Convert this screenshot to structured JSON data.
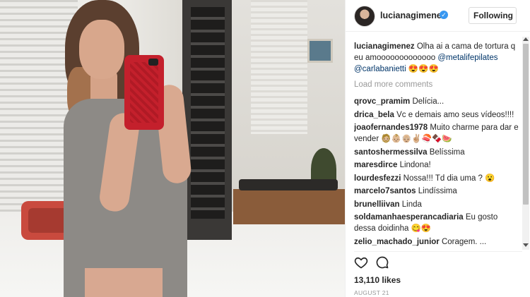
{
  "post": {
    "username": "lucianagimenez",
    "follow_label": "Following",
    "caption_user": "lucianagimenez",
    "caption_text": " Olha ai a cama de tortura q eu amooooooooooooo ",
    "caption_mention1": "@metalifepilates",
    "caption_mention2": "@carlabanietti",
    "caption_emoji": " 😍😍😍",
    "load_more": "Load more comments",
    "likes": "13,110 likes",
    "date": "AUGUST 21"
  },
  "comments": [
    {
      "user": "qrovc_pramim",
      "text": " Delícia..."
    },
    {
      "user": "drica_bela",
      "text": " Vc e demais amo seus vídeos!!!!"
    },
    {
      "user": "joaofernandes1978",
      "text": " Muito charme para dar e vender 🧔🏼👶🏼👴🏼✌🏼🍣🍫🍉"
    },
    {
      "user": "santoshermessilva",
      "text": " Belíssima"
    },
    {
      "user": "maresdirce",
      "text": " Lindona!"
    },
    {
      "user": "lourdesfezzi",
      "text": " Nossa!!! Td dia uma ? 😮"
    },
    {
      "user": "marcelo7santos",
      "text": " Lindíssima"
    },
    {
      "user": "brunelliivan",
      "text": " Linda"
    },
    {
      "user": "soldamanhaesperancadiaria",
      "text": " Eu gosto dessa doidinha 😋😍"
    },
    {
      "user": "zelio_machado_junior",
      "text": " Coragem. ..."
    }
  ],
  "colors": {
    "accent": "#3897f0",
    "link": "#003569"
  },
  "icons": [
    "verified-badge-icon",
    "heart-icon",
    "comment-icon"
  ]
}
